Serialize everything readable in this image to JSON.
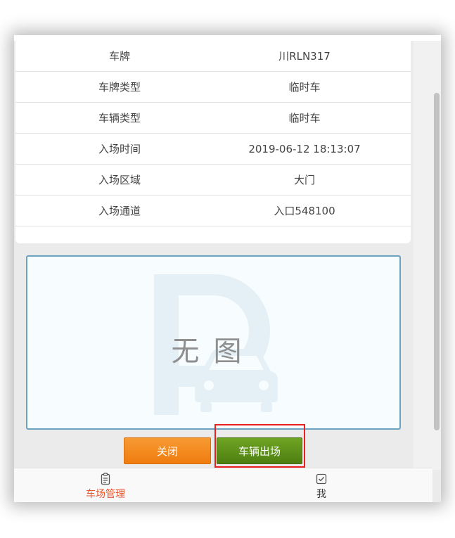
{
  "info": {
    "rows": [
      {
        "label": "车牌",
        "value": "川RLN317"
      },
      {
        "label": "车牌类型",
        "value": "临时车"
      },
      {
        "label": "车辆类型",
        "value": "临时车"
      },
      {
        "label": "入场时间",
        "value": "2019-06-12 18:13:07"
      },
      {
        "label": "入场区域",
        "value": "大门"
      },
      {
        "label": "入场通道",
        "value": "入口548100"
      }
    ]
  },
  "image": {
    "placeholder_text": "无图"
  },
  "actions": {
    "close_label": "关闭",
    "exit_label": "车辆出场"
  },
  "tabbar": {
    "items": [
      {
        "label": "车场管理",
        "icon": "clipboard-icon",
        "active": true
      },
      {
        "label": "我",
        "icon": "profile-check-icon",
        "active": false
      }
    ]
  },
  "colors": {
    "accent_active_tab": "#e8532a",
    "close_button": "#f0850f",
    "exit_button": "#5a8f18",
    "highlight_box": "#ea1f1f",
    "image_border": "#6ea3c0"
  }
}
